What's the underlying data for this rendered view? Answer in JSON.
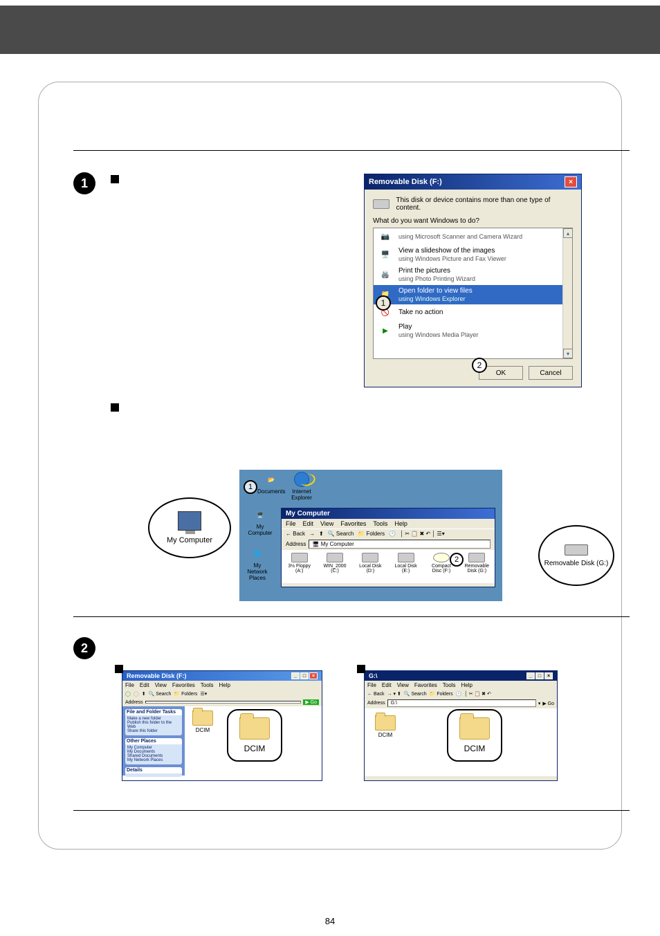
{
  "page_number": "84",
  "dialog": {
    "title": "Removable Disk (F:)",
    "message": "This disk or device contains more than one type of content.",
    "prompt": "What do you want Windows to do?",
    "options": {
      "opt0": {
        "title": "using Microsoft Scanner and Camera Wizard"
      },
      "opt1": {
        "title": "View a slideshow of the images",
        "sub": "using Windows Picture and Fax Viewer"
      },
      "opt2": {
        "title": "Print the pictures",
        "sub": "using Photo Printing Wizard"
      },
      "opt3": {
        "title": "Open folder to view files",
        "sub": "using Windows Explorer"
      },
      "opt4": {
        "title": "Take no action"
      },
      "opt5": {
        "title": "Play",
        "sub": "using Windows Media Player"
      }
    },
    "ok": "OK",
    "cancel": "Cancel"
  },
  "circled": {
    "one": "1",
    "two": "2"
  },
  "callouts": {
    "my_computer": "My Computer",
    "removable_disk": "Removable Disk (G:)",
    "dcim": "DCIM"
  },
  "desktop": {
    "documents": "Documents",
    "ie": "Internet Explorer",
    "mycomputer": "My Computer",
    "mynetwork": "My Network Places"
  },
  "explorer": {
    "title": "My Computer",
    "menu": {
      "file": "File",
      "edit": "Edit",
      "view": "View",
      "favorites": "Favorites",
      "tools": "Tools",
      "help": "Help"
    },
    "toolbar": {
      "back": "Back",
      "search": "Search",
      "folders": "Folders"
    },
    "address_label": "Address",
    "address_value": "My Computer",
    "drives": {
      "a": "3½ Floppy (A:)",
      "c": "WIN_2000 (C:)",
      "d": "Local Disk (D:)",
      "e": "Local Disk (E:)",
      "f": "Compact Disc (F:)",
      "g": "Removable Disk (G:)"
    }
  },
  "dcim_xp": {
    "title": "Removable Disk (F:)",
    "toolbar": {
      "search": "Search",
      "folders": "Folders"
    },
    "sidebar": {
      "tasks_h": "File and Folder Tasks",
      "task1": "Make a new folder",
      "task2": "Publish this folder to the Web",
      "task3": "Share this folder",
      "places_h": "Other Places",
      "place1": "My Computer",
      "place2": "My Documents",
      "place3": "Shared Documents",
      "place4": "My Network Places",
      "details_h": "Details"
    },
    "folder": "DCIM"
  },
  "dcim_2k": {
    "title": "G:\\",
    "address": "G:\\",
    "go": "Go",
    "folder": "DCIM"
  }
}
